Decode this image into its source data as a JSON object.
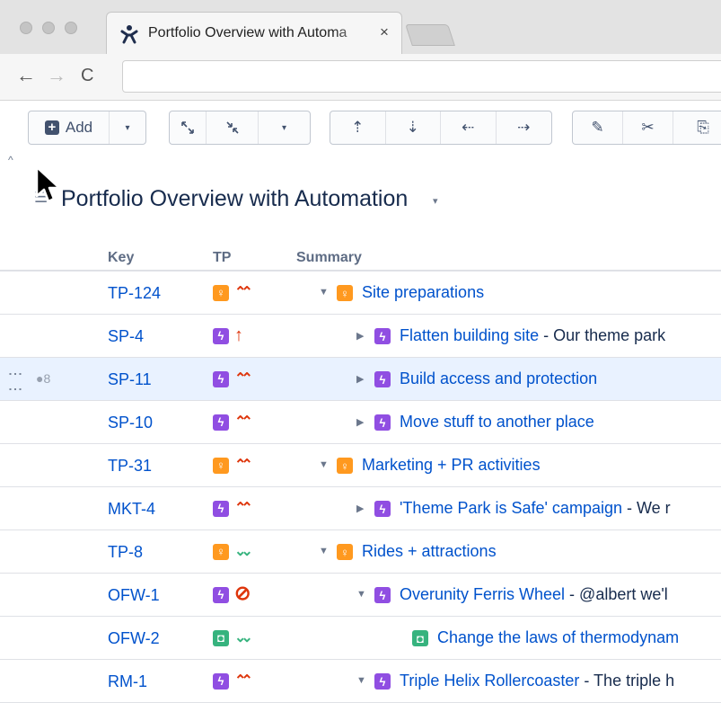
{
  "browser": {
    "tab_title": "Portfolio Overview with Automa",
    "tab_close": "×",
    "nav_back": "←",
    "nav_forward": "→",
    "nav_reload": "C",
    "url": ""
  },
  "toolbar": {
    "add_label": "Add",
    "plus": "+",
    "caret": "▾",
    "expand_icon": "↖↘",
    "collapse_icon": "↘↖",
    "move_up": "⇡",
    "move_down": "⇣",
    "outdent": "⇠",
    "indent": "⇢",
    "edit": "✎",
    "cut": "✂",
    "copy": "⎘",
    "collapse_caret": "^"
  },
  "page": {
    "title_icon": "☰",
    "title": "Portfolio Overview with Automation",
    "title_caret": "▾"
  },
  "table": {
    "headers": {
      "key": "Key",
      "tp": "TP",
      "summary": "Summary"
    },
    "rows": [
      {
        "key": "TP-124",
        "type": "idea",
        "type_glyph": "♀",
        "prio": "⌃⌃",
        "prio_kind": "high",
        "toggle": "▼",
        "summary": "Site preparations",
        "desc": ""
      },
      {
        "key": "SP-4",
        "type": "epic",
        "type_glyph": "ϟ",
        "prio": "↑",
        "prio_kind": "highest",
        "toggle": "▶",
        "summary": "Flatten building site",
        "desc": " - Our theme park"
      },
      {
        "key": "SP-11",
        "type": "epic",
        "type_glyph": "ϟ",
        "prio": "⌃⌃",
        "prio_kind": "high",
        "toggle": "▶",
        "summary": "Build access and protection",
        "desc": "",
        "row_count": "●8",
        "drag": "⋮⋮"
      },
      {
        "key": "SP-10",
        "type": "epic",
        "type_glyph": "ϟ",
        "prio": "⌃⌃",
        "prio_kind": "high",
        "toggle": "▶",
        "summary": "Move stuff to another place",
        "desc": ""
      },
      {
        "key": "TP-31",
        "type": "idea",
        "type_glyph": "♀",
        "prio": "⌃⌃",
        "prio_kind": "high",
        "toggle": "▼",
        "summary": "Marketing + PR activities",
        "desc": ""
      },
      {
        "key": "MKT-4",
        "type": "epic",
        "type_glyph": "ϟ",
        "prio": "⌃⌃",
        "prio_kind": "high",
        "toggle": "▶",
        "summary": "'Theme Park is Safe' campaign",
        "desc": " - We r"
      },
      {
        "key": "TP-8",
        "type": "idea",
        "type_glyph": "♀",
        "prio": "⌄⌄",
        "prio_kind": "low",
        "toggle": "▼",
        "summary": "Rides + attractions",
        "desc": ""
      },
      {
        "key": "OFW-1",
        "type": "epic",
        "type_glyph": "ϟ",
        "prio": "⊘",
        "prio_kind": "blocker",
        "toggle": "▼",
        "summary": "Overunity Ferris Wheel",
        "desc": " - @albert we'l"
      },
      {
        "key": "OFW-2",
        "type": "story",
        "type_glyph": "◘",
        "prio": "⌄⌄",
        "prio_kind": "low",
        "toggle": "",
        "summary": "Change the laws of thermodynam",
        "desc": ""
      },
      {
        "key": "RM-1",
        "type": "epic",
        "type_glyph": "ϟ",
        "prio": "⌃⌃",
        "prio_kind": "high",
        "toggle": "▼",
        "summary": "Triple Helix Rollercoaster",
        "desc": " - The triple h"
      }
    ]
  },
  "colors": {
    "idea": "#ff991f",
    "epic": "#904ee2",
    "story": "#36b37e",
    "high": "#de350b",
    "highest": "#de350b",
    "blocker": "#de350b",
    "low": "#36b37e",
    "link": "#0052cc",
    "row_highlight": "#e9f2ff"
  }
}
